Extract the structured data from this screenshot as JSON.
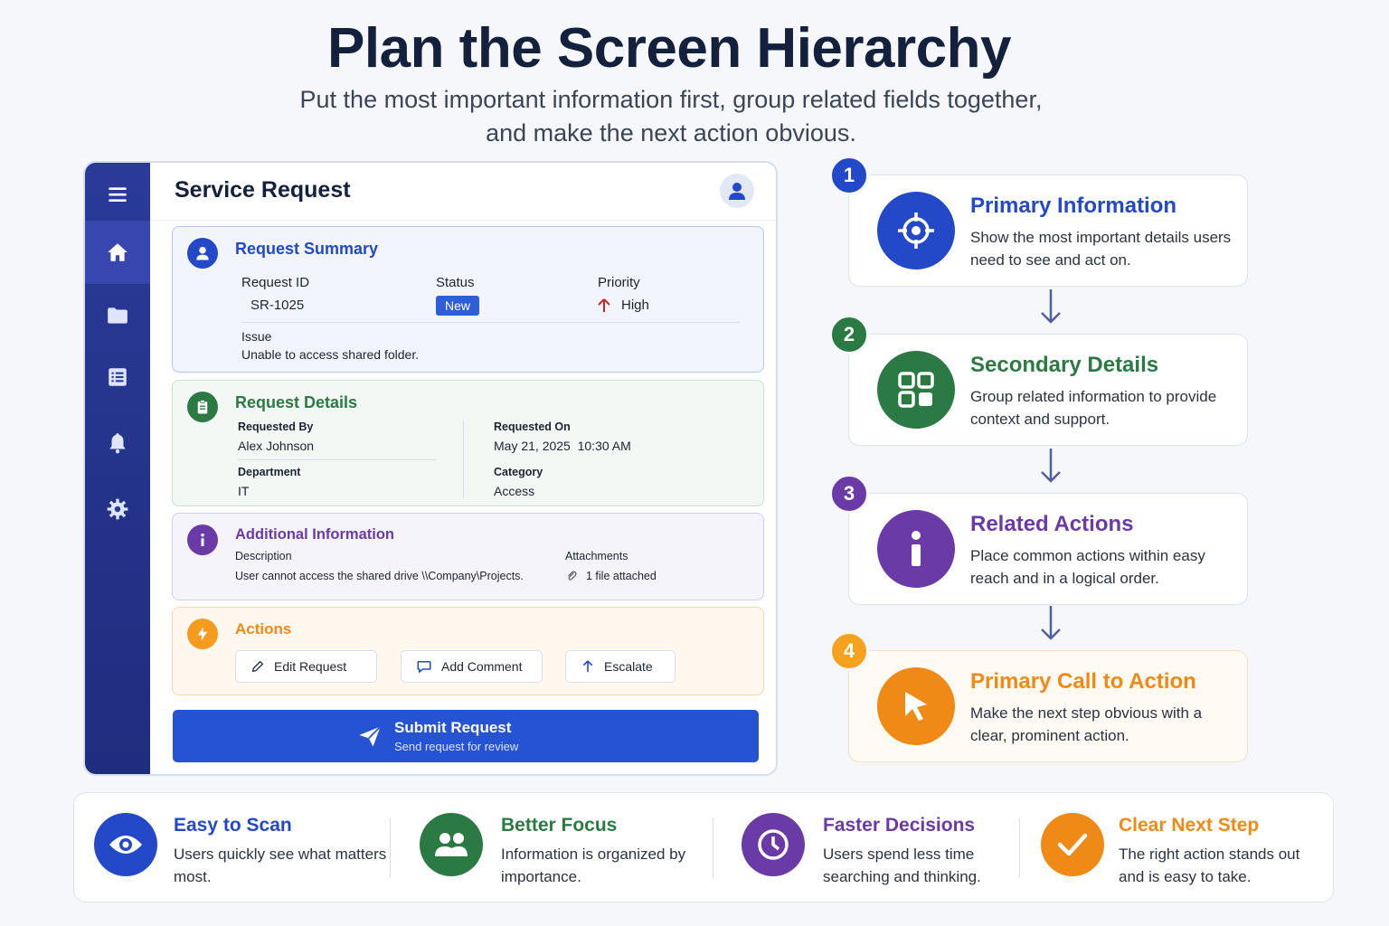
{
  "page": {
    "title": "Plan the Screen Hierarchy",
    "subtitle_line1": "Put the most important information first, group related fields together,",
    "subtitle_line2": "and make the next action obvious."
  },
  "app": {
    "title": "Service Request",
    "sidebar": [
      {
        "icon": "menu-icon"
      },
      {
        "icon": "home-icon",
        "active": true
      },
      {
        "icon": "folder-icon"
      },
      {
        "icon": "list-icon"
      },
      {
        "icon": "bell-icon"
      },
      {
        "icon": "gear-icon"
      }
    ],
    "summary": {
      "title": "Request Summary",
      "request_id_label": "Request ID",
      "request_id": "SR-1025",
      "status_label": "Status",
      "status": "New",
      "priority_label": "Priority",
      "priority": "High",
      "issue_label": "Issue",
      "issue": "Unable to access shared folder."
    },
    "details": {
      "title": "Request Details",
      "requested_by_label": "Requested By",
      "requested_by": "Alex Johnson",
      "requested_on_label": "Requested On",
      "requested_on": "May 21, 2025  10:30 AM",
      "department_label": "Department",
      "department": "IT",
      "category_label": "Category",
      "category": "Access"
    },
    "additional": {
      "title": "Additional Information",
      "description_label": "Description",
      "description": "User cannot access the shared drive \\\\Company\\Projects.",
      "attachments_label": "Attachments",
      "attachments": "1 file attached"
    },
    "actions": {
      "title": "Actions",
      "edit": "Edit Request",
      "comment": "Add Comment",
      "escalate": "Escalate"
    },
    "submit": {
      "label": "Submit Request",
      "sublabel": "Send request for review"
    }
  },
  "steps": [
    {
      "num": "1",
      "title": "Primary Information",
      "desc": "Show the most important details users need to see and act on.",
      "color": "#2348c8"
    },
    {
      "num": "2",
      "title": "Secondary Details",
      "desc": "Group related information to provide context and support.",
      "color": "#2c7a43"
    },
    {
      "num": "3",
      "title": "Related Actions",
      "desc": "Place common actions within easy reach and in a logical order.",
      "color": "#6a3aa6"
    },
    {
      "num": "4",
      "title": "Primary Call to Action",
      "desc": "Make the next step obvious with a clear, prominent action.",
      "color": "#f08a17"
    }
  ],
  "benefits": [
    {
      "title": "Easy to Scan",
      "desc": "Users quickly see what matters most.",
      "color": "#2348c8"
    },
    {
      "title": "Better Focus",
      "desc": "Information is organized by importance.",
      "color": "#2c7a43"
    },
    {
      "title": "Faster Decisions",
      "desc": "Users spend less time searching and thinking.",
      "color": "#6a3aa6"
    },
    {
      "title": "Clear Next Step",
      "desc": "The right action stands out and is easy to take.",
      "color": "#f08a17"
    }
  ]
}
